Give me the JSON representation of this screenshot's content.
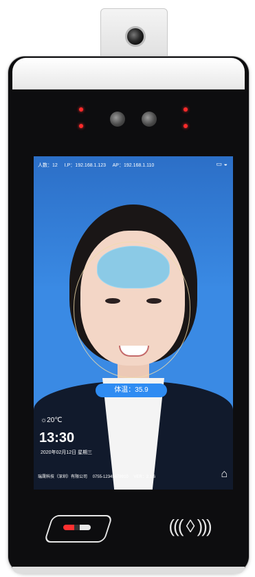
{
  "status_bar": {
    "people_count": "人数：12",
    "ip": "I.P：192.168.1.123",
    "ap": "AP：192.168.1.110",
    "icons": [
      "signal-icon",
      "wifi-icon"
    ]
  },
  "temperature_label": "体温：35.9",
  "weather": {
    "icon": "sun-icon",
    "temperature": "☼20℃"
  },
  "time": "13:30",
  "date": "2020年02月12日 星期三",
  "footer": {
    "company": "瑞晟科技（深圳）有限公司",
    "phone": "0755-12345678910",
    "version": "VER：2.1.6"
  },
  "home_icon": "home-icon",
  "nfc_symbol": "((( ◊ )))",
  "colors": {
    "device_body": "#0d0d0f",
    "screen_bg": "#3a8ae4",
    "temp_pill": "#2f8cf2",
    "ir_led": "#ff2a2a"
  }
}
